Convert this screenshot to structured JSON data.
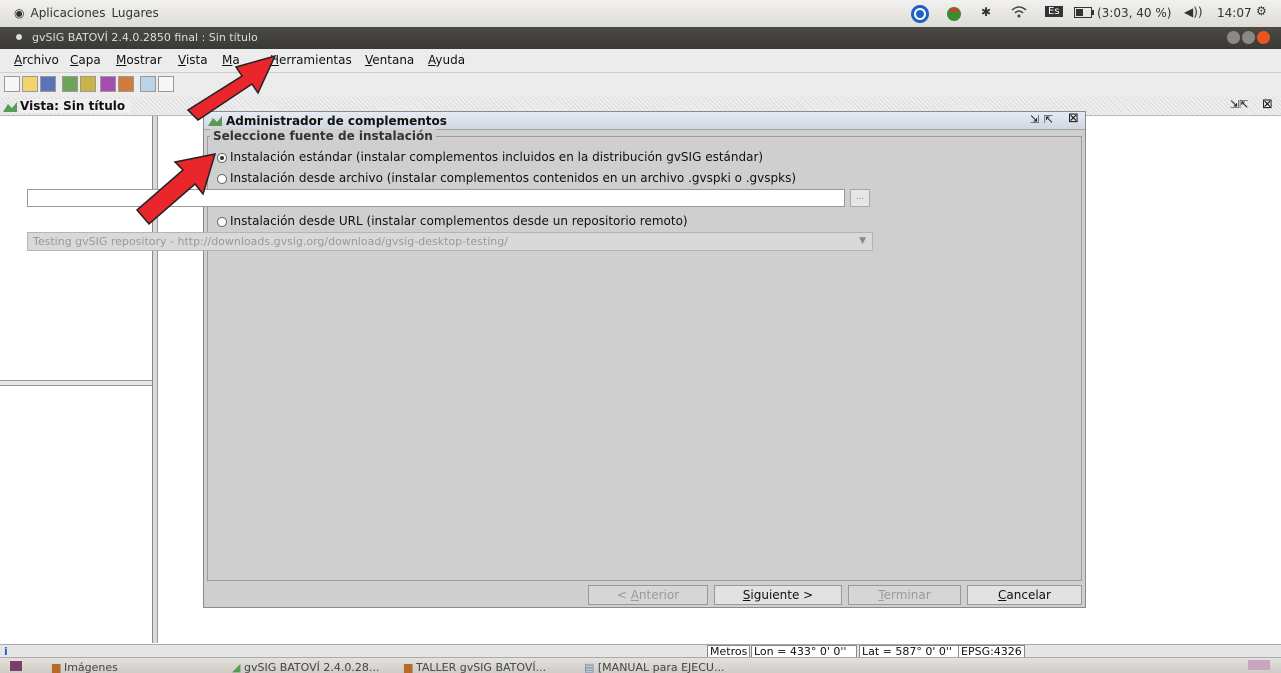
{
  "topbar": {
    "menu_apps": "Aplicaciones",
    "menu_places": "Lugares",
    "keyboard_layout": "Es",
    "battery": "(3:03, 40 %)",
    "clock": "14:07"
  },
  "window": {
    "title": "gvSIG BATOVÍ 2.4.0.2850 final : Sin título"
  },
  "menubar": {
    "archivo_u": "A",
    "archivo_rest": "rchivo",
    "capa_u": "C",
    "capa_rest": "apa",
    "mostrar_u": "M",
    "mostrar_rest": "ostrar",
    "vista_u": "V",
    "vista_rest": "ista",
    "mapa_u": "M",
    "mapa_rest": "a",
    "herramientas_u": "H",
    "herramientas_rest": "erramientas",
    "ventana_u": "V",
    "ventana_rest": "entana",
    "ayuda_u": "A",
    "ayuda_rest": "yuda"
  },
  "view": {
    "title": "Vista: Sin título"
  },
  "dialog": {
    "title": "Administrador de complementos",
    "section": "Seleccione fuente de instalación",
    "option_standard": "Instalación estándar (instalar complementos incluidos en la distribución gvSIG estándar)",
    "option_file": "Instalación desde archivo (instalar complementos contenidos en un archivo .gvspki o .gvspks)",
    "file_value": "",
    "browse_label": "...",
    "option_url": "Instalación desde URL (instalar complementos desde un repositorio remoto)",
    "repo_selected": "Testing gvSIG repository - http://downloads.gvsig.org/download/gvsig-desktop-testing/",
    "btn_back_prefix": "< ",
    "btn_back_u": "A",
    "btn_back_rest": "nterior",
    "btn_next_u": "S",
    "btn_next_rest": "iguiente >",
    "btn_finish_u": "T",
    "btn_finish_rest": "erminar",
    "btn_cancel_u": "C",
    "btn_cancel_rest": "ancelar"
  },
  "status": {
    "units": "Metros",
    "lon": "Lon = 433° 0' 0''",
    "lat": "Lat = 587° 0' 0''",
    "crs": "EPSG:4326"
  },
  "taskbar": {
    "item1": "Imágenes",
    "item2": "gvSIG BATOVÍ 2.4.0.28...",
    "item3": "TALLER gvSIG BATOVÍ...",
    "item4": "[MANUAL para EJECU..."
  },
  "colors": {
    "annotation_arrow": "#e8262b"
  }
}
